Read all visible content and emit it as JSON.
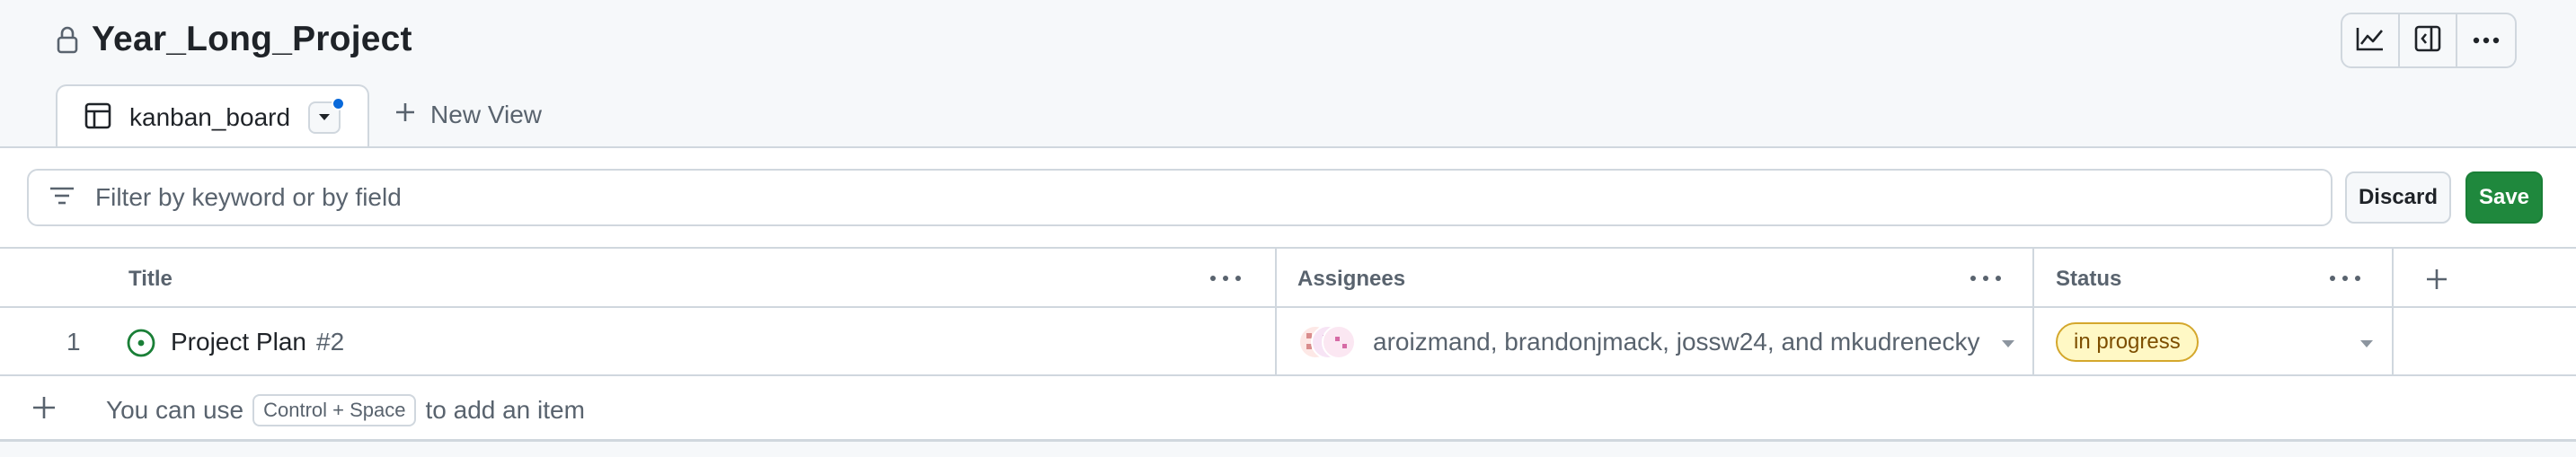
{
  "project": {
    "title": "Year_Long_Project"
  },
  "toolbar": {
    "icons": [
      "insights-icon",
      "panel-icon",
      "more-icon"
    ]
  },
  "tabs": [
    {
      "label": "kanban_board"
    }
  ],
  "new_view": {
    "label": "New View"
  },
  "filter": {
    "placeholder": "Filter by keyword or by field",
    "discard_label": "Discard",
    "save_label": "Save"
  },
  "table": {
    "columns": [
      {
        "label": "Title"
      },
      {
        "label": "Assignees"
      },
      {
        "label": "Status"
      }
    ],
    "rows": [
      {
        "index": "1",
        "title": "Project Plan",
        "number": "#2",
        "assignees": "aroizmand, brandonjmack, jossw24, and mkudrenecky",
        "status": "in progress"
      }
    ],
    "add_hint": {
      "before": "You can use",
      "kbd": "Control + Space",
      "after": "to add an item"
    }
  },
  "colors": {
    "accent": "#0969da",
    "save_green": "#1f883d",
    "open_issue_green": "#1a7f37",
    "status_bg": "#fff8c5",
    "status_border": "#d4a72c"
  }
}
